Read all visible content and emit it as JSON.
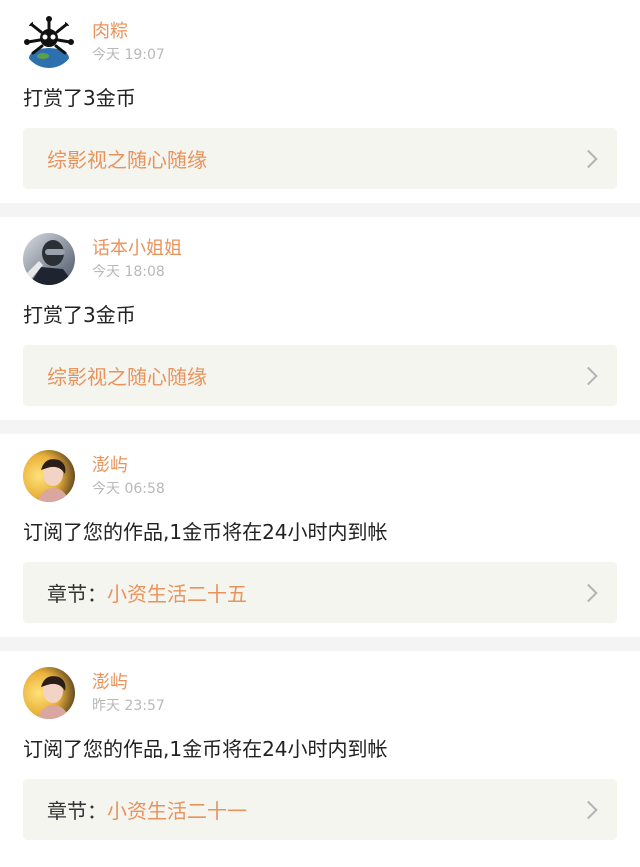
{
  "items": [
    {
      "username": "肉粽",
      "time": "今天 19:07",
      "message": "打赏了3金币",
      "link_prefix": "",
      "link_text": "综影视之随心随缘"
    },
    {
      "username": "话本小姐姐",
      "time": "今天 18:08",
      "message": "打赏了3金币",
      "link_prefix": "",
      "link_text": "综影视之随心随缘"
    },
    {
      "username": "澎屿",
      "time": "今天 06:58",
      "message": "订阅了您的作品,1金币将在24小时内到帐",
      "link_prefix": "章节：",
      "link_text": "小资生活二十五"
    },
    {
      "username": "澎屿",
      "time": "昨天 23:57",
      "message": "订阅了您的作品,1金币将在24小时内到帐",
      "link_prefix": "章节：",
      "link_text": "小资生活二十一"
    }
  ],
  "colors": {
    "accent": "#e8935c",
    "muted": "#b9b9b9",
    "link_bg": "#f5f5f0",
    "separator": "#f4f4f4"
  }
}
